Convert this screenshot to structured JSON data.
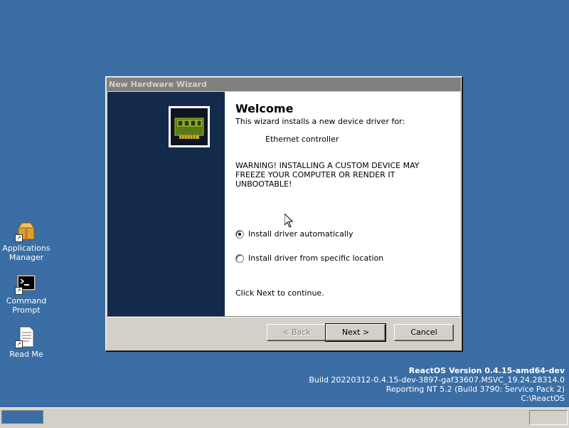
{
  "desktop": {
    "icons": [
      {
        "label_line1": "Applications",
        "label_line2": "Manager",
        "icon": "package-icon"
      },
      {
        "label_line1": "Command",
        "label_line2": "Prompt",
        "icon": "terminal-icon"
      },
      {
        "label_line1": "Read Me",
        "label_line2": "",
        "icon": "document-icon"
      }
    ]
  },
  "dialog": {
    "title": "New Hardware Wizard",
    "heading": "Welcome",
    "subtext": "This wizard installs a new device driver for:",
    "device": "Ethernet controller",
    "warning": "WARNING! INSTALLING A CUSTOM DEVICE MAY FREEZE YOUR COMPUTER OR RENDER IT UNBOOTABLE!",
    "option_auto": "Install driver automatically",
    "option_specific": "Install driver from specific location",
    "selected_option": "auto",
    "instruction": "Click Next to continue.",
    "buttons": {
      "back": "< Back",
      "next": "Next >",
      "cancel": "Cancel"
    }
  },
  "version_info": {
    "line1": "ReactOS Version 0.4.15-amd64-dev",
    "line2": "Build 20220312-0.4.15-dev-3897-gaf33607.MSVC_19.24.28314.0",
    "line3": "Reporting NT 5.2 (Build 3790: Service Pack 2)",
    "line4": "C:\\ReactOS"
  },
  "colors": {
    "desktop": "#3a6ea5",
    "wizard_sidebar": "#132a4c",
    "titlebar_inactive": "#808080"
  }
}
